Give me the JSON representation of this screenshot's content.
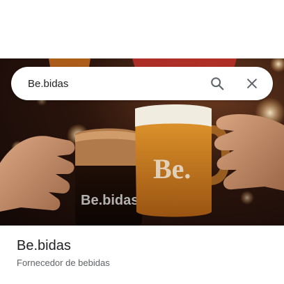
{
  "search": {
    "value": "Be.bidas",
    "search_icon": "search-icon",
    "close_icon": "close-icon"
  },
  "photo": {
    "logo_left_mug": "Be.bidas",
    "logo_right_mug": "Be."
  },
  "place": {
    "name": "Be.bidas",
    "category": "Fornecedor de bebidas"
  },
  "colors": {
    "text_primary": "#202124",
    "text_secondary": "#5f6368",
    "icon": "#5f6368"
  }
}
